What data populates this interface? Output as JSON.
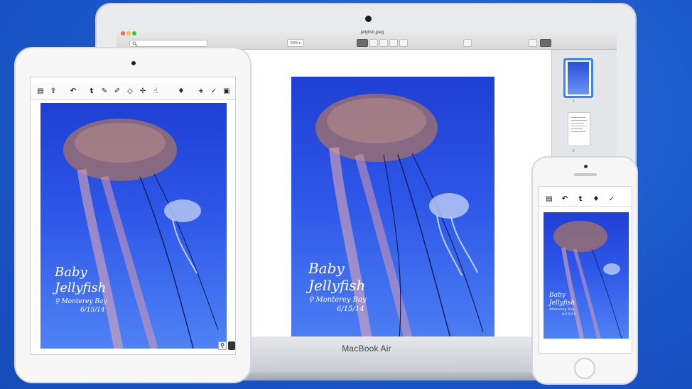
{
  "macbook": {
    "brand": "MacBook Air",
    "window_title": "jellyfish.jpeg",
    "zoom_select": "50% ▾",
    "sidebar_pages": [
      "1",
      "2"
    ]
  },
  "artwork": {
    "title_line1": "Baby",
    "title_line2": "Jellyfish",
    "location": "Monterey Bay",
    "date": "6/15/14"
  },
  "ipad": {
    "toolbar_icons": [
      "text-tool-icon",
      "pen-icon",
      "highlighter-icon",
      "eraser-icon",
      "crop-icon",
      "hand-icon",
      "microphone-icon",
      "plus-icon",
      "wrench-icon",
      "pages-icon"
    ]
  },
  "iphone": {
    "toolbar_icons": [
      "library-icon",
      "undo-icon",
      "text-tool-icon",
      "microphone-icon",
      "wrench-icon"
    ]
  },
  "colors": {
    "background": "#1f5fd0",
    "selection": "#3b85ee",
    "jelly_sky": "#2d57e8"
  }
}
